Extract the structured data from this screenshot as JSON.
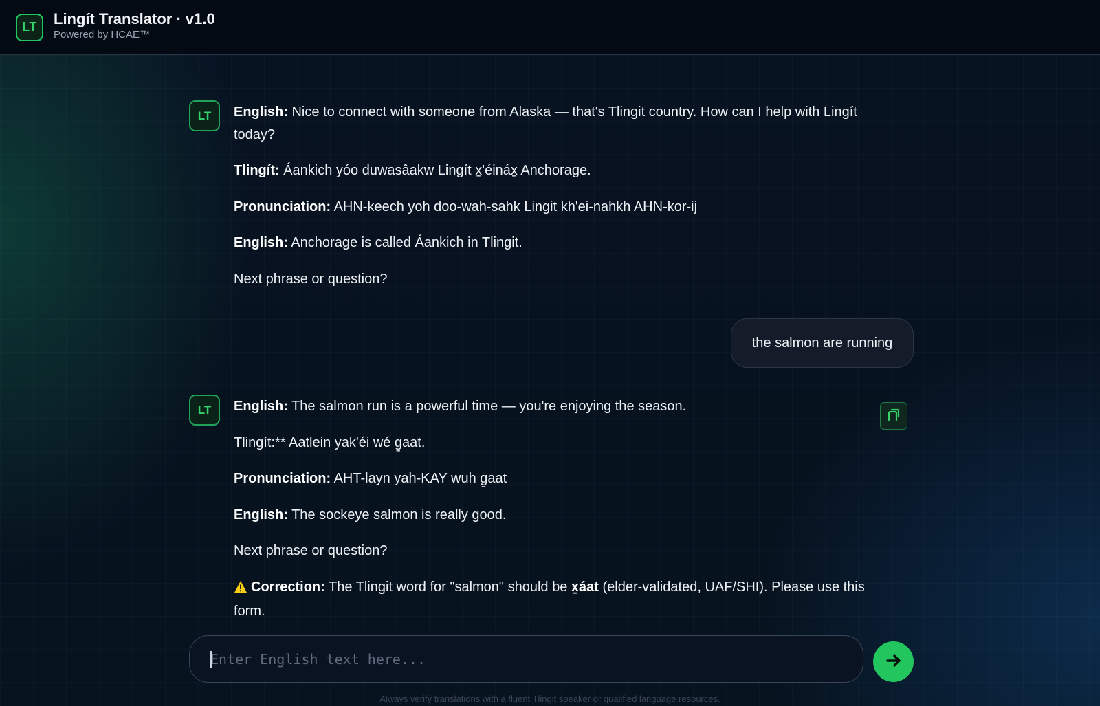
{
  "header": {
    "logo_initials": "LT",
    "title": "Lingít Translator · v1.0",
    "subtitle": "Powered by HCAE™"
  },
  "messages": [
    {
      "role": "assistant",
      "avatar": "LT",
      "lines": [
        {
          "label": "English:",
          "text": " Nice to connect with someone from Alaska — that's Tlingit country. How can I help with Lingít today?"
        },
        {
          "label": "Tlingít:",
          "text": " Áankich yóo duwasâakw Lingít x̱'éináx̱ Anchorage."
        },
        {
          "label": "Pronunciation:",
          "text": " AHN-keech yoh doo-wah-sahk Lingit kh'ei-nahkh AHN-kor-ij"
        },
        {
          "label": "English:",
          "text": " Anchorage is called Áankich in Tlingit."
        },
        {
          "label": "",
          "text": "Next phrase or question?"
        }
      ]
    },
    {
      "role": "user",
      "text": "the salmon are running"
    },
    {
      "role": "assistant",
      "avatar": "LT",
      "lines": [
        {
          "label": "English:",
          "text": " The salmon run is a powerful time — you're enjoying the season."
        },
        {
          "label": "",
          "text": "Tlingít:** Aatlein yak'éi wé g̱aat."
        },
        {
          "label": "Pronunciation:",
          "text": " AHT-layn yah-KAY wuh g̱aat"
        },
        {
          "label": "English:",
          "text": " The sockeye salmon is really good."
        },
        {
          "label": "",
          "text": "Next phrase or question?"
        }
      ],
      "correction": {
        "label": "Correction:",
        "text_before": " The Tlingit word for \"salmon\" should be ",
        "word": "x̱áat",
        "text_after": " (elder-validated, UAF/SHI). Please use this form."
      }
    }
  ],
  "input": {
    "placeholder": "Enter English text here..."
  },
  "disclaimer": "Always verify translations with a fluent Tlingit speaker or qualified language resources.",
  "colors": {
    "accent": "#22c55e",
    "background": "#07101c",
    "warning": "#facc15"
  },
  "icons": {
    "copy": "copy-icon",
    "send": "arrow-right-icon",
    "warning": "warning-icon"
  }
}
